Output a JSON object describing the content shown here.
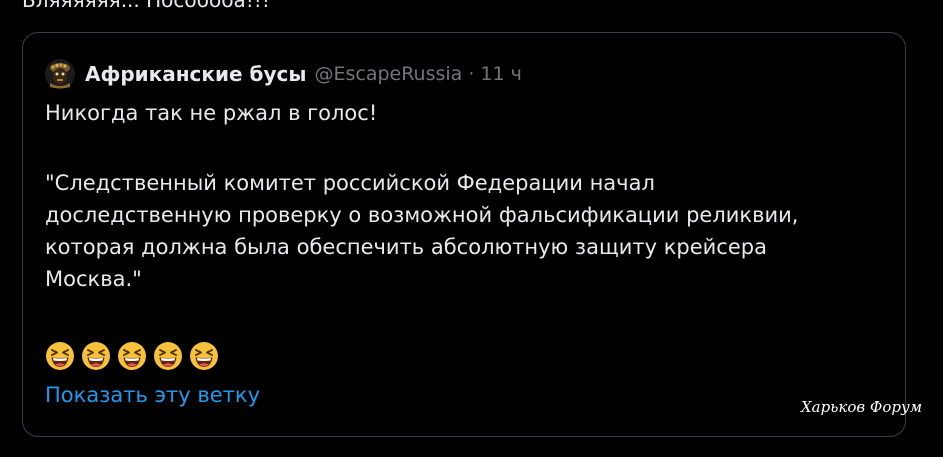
{
  "previous_tweet": {
    "text_fragment": "Бляяяяяя... Пособоба!!!"
  },
  "quoted_tweet": {
    "author": {
      "display_name": "Африканские бусы",
      "handle": "@EscapeRussia",
      "avatar_icon": "bead-mask-avatar-icon"
    },
    "separator": "·",
    "timestamp": "11 ч",
    "text_line_1": "Никогда так не ржал в голос!",
    "text_quote": "\"Следственный комитет российской Федерации начал\nдоследственную проверку о возможной фальсификации реликвии,\nкоторая должна была обеспечить абсолютную защиту крейсера\nМосква.\"",
    "emoji": [
      "grinning-squinting-face-icon",
      "grinning-squinting-face-icon",
      "grinning-squinting-face-icon",
      "grinning-squinting-face-icon",
      "grinning-squinting-face-icon"
    ],
    "show_thread_label": "Показать эту ветку"
  },
  "watermark": "Харьков Форум",
  "colors": {
    "background": "#000000",
    "text_primary": "#e7e9ea",
    "text_secondary": "#71767b",
    "link": "#1d9bf0",
    "card_border": "#3b3f43"
  }
}
